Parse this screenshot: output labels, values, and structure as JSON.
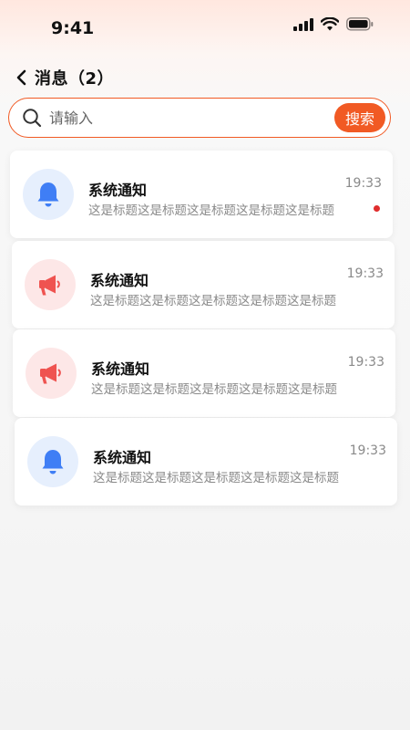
{
  "status_bar": {
    "time": "9:41",
    "icons": [
      "signal-icon",
      "wifi-icon",
      "battery-icon"
    ]
  },
  "header": {
    "back_icon": "chevron-left-icon",
    "title": "消息（2）"
  },
  "search": {
    "placeholder": "请输入",
    "value": "",
    "button_label": "搜索",
    "icon": "search-icon",
    "accent_color": "#f15a24"
  },
  "messages": [
    {
      "icon": "bell-icon",
      "icon_color": "#3f7ef5",
      "title": "系统通知",
      "preview": "这是标题这是标题这是标题这是标题这是标题",
      "time": "19:33",
      "unread": true
    },
    {
      "icon": "megaphone-icon",
      "icon_color": "#ef5350",
      "title": "系统通知",
      "preview": "这是标题这是标题这是标题这是标题这是标题",
      "time": "19:33",
      "unread": false
    },
    {
      "icon": "megaphone-icon",
      "icon_color": "#ef5350",
      "title": "系统通知",
      "preview": "这是标题这是标题这是标题这是标题这是标题",
      "time": "19:33",
      "unread": false
    },
    {
      "icon": "bell-icon",
      "icon_color": "#3f7ef5",
      "title": "系统通知",
      "preview": "这是标题这是标题这是标题这是标题这是标题",
      "time": "19:33",
      "unread": false
    }
  ]
}
